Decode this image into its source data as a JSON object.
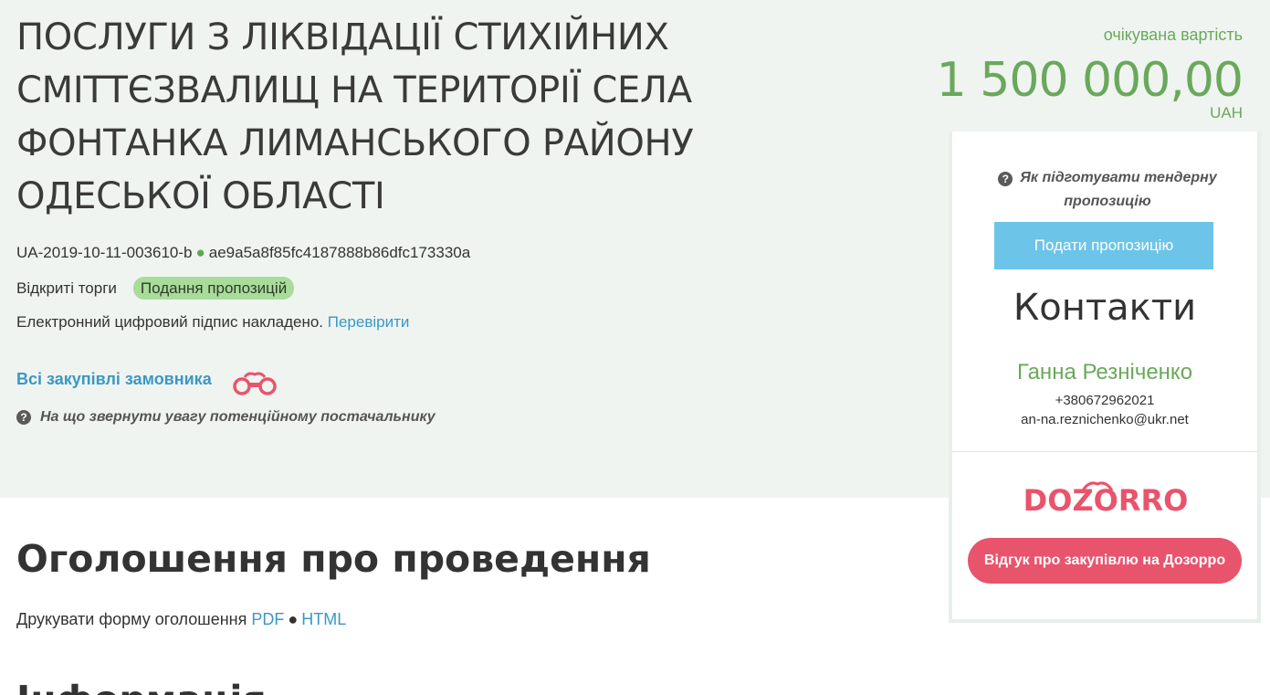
{
  "tender": {
    "title": "ПОСЛУГИ З ЛІКВІДАЦІЇ СТИХІЙНИХ СМІТТЄЗВАЛИЩ НА ТЕРИТОРІЇ СЕЛА ФОНТАНКА ЛИМАНСЬКОГО РАЙОНУ ОДЕСЬКОЇ ОБЛАСТІ",
    "id": "UA-2019-10-11-003610-b",
    "id_separator": "●",
    "hash": "ae9a5a8f85fc4187888b86dfc173330a",
    "procedure": "Відкриті торги",
    "status_badge": "Подання пропозицій",
    "signature_text": "Електронний цифровий підпис накладено.",
    "signature_link": "Перевірити",
    "buyer_link": "Всі закупівлі замовника",
    "supplier_hint": "На що звернути увагу потенційному постачальнику"
  },
  "price": {
    "label": "очікувана вартість",
    "value": "1 500 000,00",
    "currency": "UAH"
  },
  "sidebar": {
    "hint": "Як підготувати тендерну пропозицію",
    "submit_label": "Подати пропозицію",
    "contacts_title": "Контакти",
    "contact_name": "Ганна Резніченко",
    "contact_phone": "+380672962021",
    "contact_email": "an-na.reznichenko@ukr.net",
    "dozorro_logo": "DOZORRO",
    "review_label": "Відгук про закупівлю на Дозорро"
  },
  "announcement": {
    "title": "Оголошення про проведення",
    "print_text": "Друкувати форму оголошення",
    "pdf_link": "PDF",
    "separator": "●",
    "html_link": "HTML",
    "next_heading": "Інформація"
  },
  "icons": {
    "binoculars": "binoculars-icon",
    "question": "question-circle-icon"
  },
  "colors": {
    "accent_green": "#6aa85b",
    "link_blue": "#3a98c5",
    "submit_blue": "#6cc4e8",
    "dozorro_red": "#e8546c",
    "hero_bg": "#eff4f1"
  }
}
